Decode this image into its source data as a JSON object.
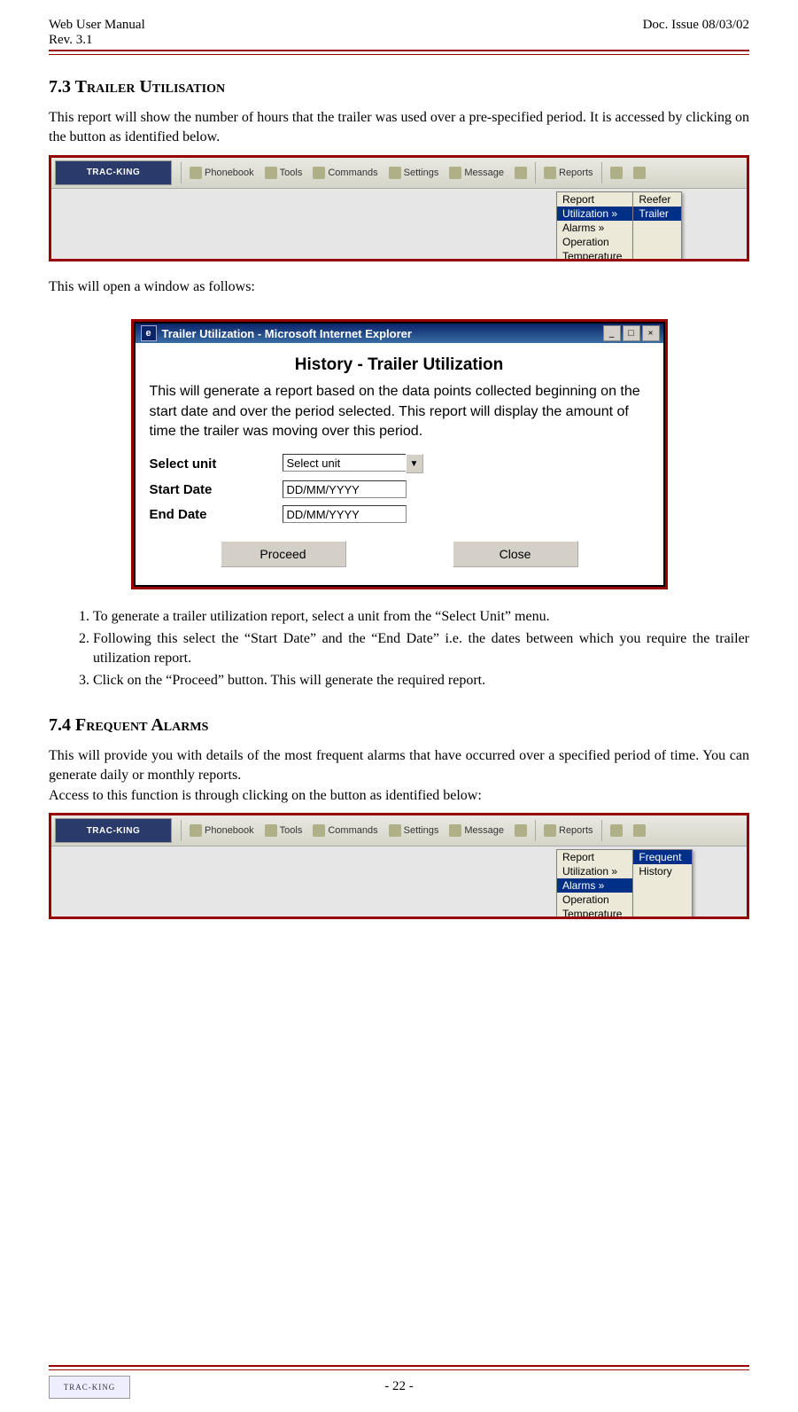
{
  "header": {
    "left1": "Web User Manual",
    "left2": "Rev. 3.1",
    "right1": "Doc. Issue 08/03/02"
  },
  "section73": {
    "heading": "7.3 Trailer Utilisation",
    "para1": "This report will show the number of hours that the trailer was used over a pre-specified period.  It is accessed by clicking on the button as identified below."
  },
  "toolbar": {
    "logo": "TRAC-KING",
    "items": [
      "Phonebook",
      "Tools",
      "Commands",
      "Settings",
      "Message",
      "",
      "Reports",
      "",
      ""
    ]
  },
  "reportsMenu1": {
    "header": "Report",
    "items": [
      {
        "label": "Utilization  »",
        "sel": true
      },
      {
        "label": "Alarms  »",
        "sel": false
      },
      {
        "label": "Operation",
        "sel": false
      },
      {
        "label": "Temperature",
        "sel": false
      }
    ],
    "sub": [
      {
        "label": "Reefer",
        "sel": false
      },
      {
        "label": "Trailer",
        "sel": true
      }
    ]
  },
  "midText": "This will open a window as follows:",
  "dialog": {
    "title": "Trailer Utilization - Microsoft Internet Explorer",
    "heading": "History - Trailer Utilization",
    "desc": "This will generate a report based on the data points collected beginning on the start date and over the period selected. This report will display the amount of time the trailer was moving over this period.",
    "rows": {
      "unitLabel": "Select unit",
      "unitValue": "Select unit",
      "startLabel": "Start Date",
      "startValue": "DD/MM/YYYY",
      "endLabel": "End Date",
      "endValue": "DD/MM/YYYY"
    },
    "buttons": {
      "proceed": "Proceed",
      "close": "Close"
    },
    "winbtns": {
      "min": "_",
      "max": "□",
      "close": "×"
    }
  },
  "steps": [
    "To generate a trailer utilization report, select a unit from the “Select Unit” menu.",
    "Following this select the “Start Date” and the “End Date” i.e. the dates between which you require the trailer utilization report.",
    "Click on the “Proceed” button.  This will generate the required report."
  ],
  "section74": {
    "heading": "7.4 Frequent Alarms",
    "para1": "This will provide you with details of the most frequent alarms that have occurred over a specified period of time.  You can generate daily or monthly reports.",
    "para2": "Access to this function is through clicking on the button as identified below:"
  },
  "reportsMenu2": {
    "header": "Report",
    "items": [
      {
        "label": "Utilization  »",
        "sel": false
      },
      {
        "label": "Alarms  »",
        "sel": true
      },
      {
        "label": "Operation",
        "sel": false
      },
      {
        "label": "Temperature",
        "sel": false
      }
    ],
    "sub": [
      {
        "label": "Frequent",
        "sel": true
      },
      {
        "label": "History",
        "sel": false
      }
    ]
  },
  "footer": {
    "logo": "TRAC-KING",
    "page": "- 22 -"
  }
}
